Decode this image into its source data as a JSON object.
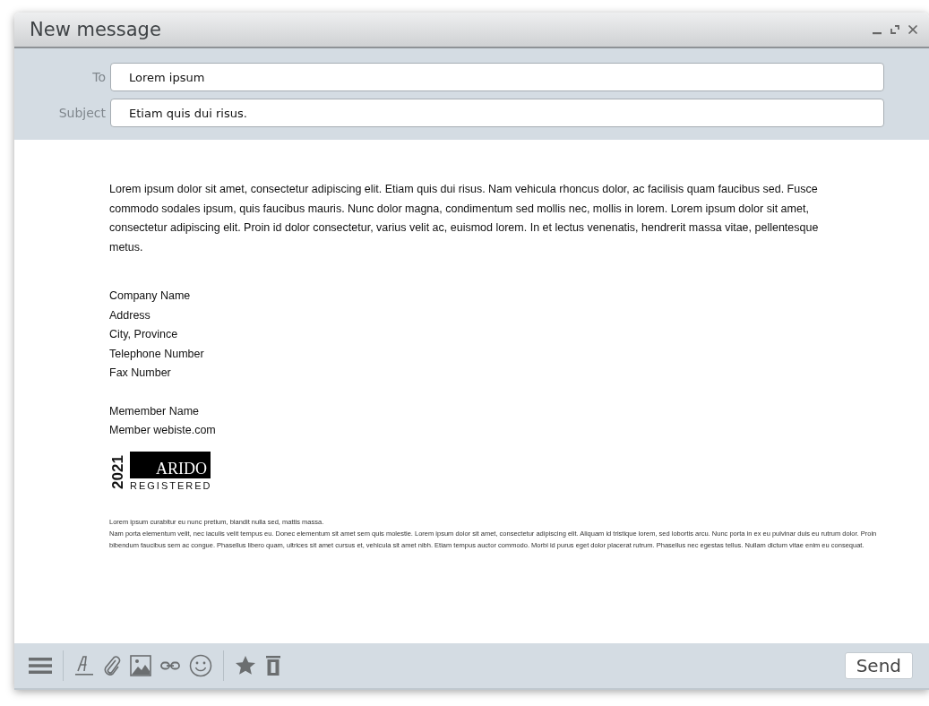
{
  "window": {
    "title": "New message"
  },
  "fields": [
    {
      "label": "To",
      "value": "Lorem ipsum"
    },
    {
      "label": "Subject",
      "value": "Etiam quis dui risus."
    }
  ],
  "body": {
    "paragraph": "Lorem ipsum dolor sit amet, consectetur adipiscing elit. Etiam quis dui risus. Nam vehicula rhoncus dolor, ac facilisis quam faucibus sed. Fusce commodo sodales ipsum, quis faucibus mauris. Nunc dolor magna, condimentum sed mollis nec, mollis in lorem. Lorem ipsum dolor sit amet, consectetur adipiscing elit. Proin id dolor consectetur, varius velit ac, euismod lorem. In et lectus venenatis, hendrerit massa vitae, pellentesque metus.",
    "company_lines": [
      "Company Name",
      "Address",
      "City, Province",
      "Telephone Number",
      "Fax Number"
    ],
    "member_lines": [
      "Memember Name",
      "Member webiste.com"
    ],
    "logo": {
      "year": "2021",
      "brand": "ARIDO",
      "caption": "REGISTERED"
    },
    "fine_print": [
      "Lorem ipsum curabitur eu nunc pretium, blandit nulla sed, mattis massa.",
      "Nam porta elementum velit, nec iaculis velit tempus eu. Donec elementum sit amet sem quis molestie. Lorem ipsum dolor sit amet, consectetur adipiscing elit. Aliquam id tristique lorem, sed lobortis arcu. Nunc porta in ex eu pulvinar duis eu rutrum dolor. Proin bibendum faucibus sem ac congue. Phasellus libero quam, ultrices sit amet cursus et, vehicula sit amet nibh. Etiam tempus auctor commodo. Morbi id purus eget dolor placerat rutrum. Phasellus nec egestas tellus. Nullam dictum vitae enim eu consequat."
    ]
  },
  "toolbar": {
    "send_label": "Send"
  }
}
